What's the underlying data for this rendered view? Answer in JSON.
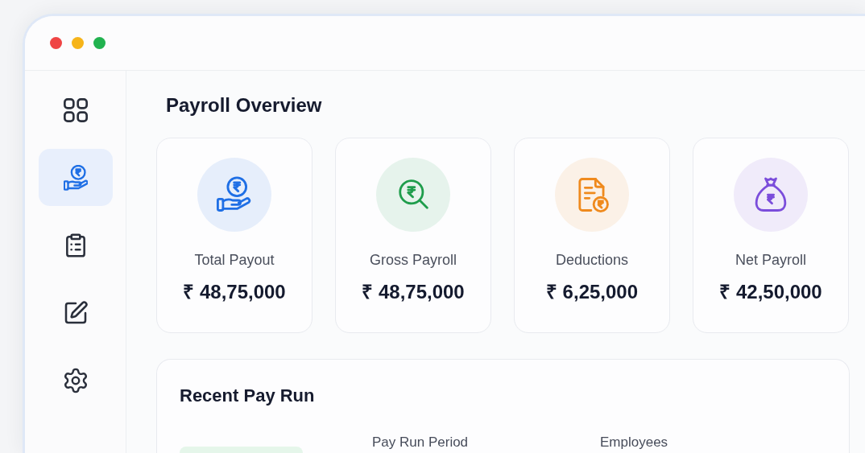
{
  "sidebar": {
    "items": [
      {
        "selected": false
      },
      {
        "selected": true
      },
      {
        "selected": false
      },
      {
        "selected": false
      },
      {
        "selected": false
      }
    ]
  },
  "overview": {
    "title": "Payroll Overview",
    "cards": [
      {
        "label": "Total Payout",
        "value": "₹ 48,75,000",
        "color": "#1f6fe5"
      },
      {
        "label": "Gross Payroll",
        "value": "₹ 48,75,000",
        "color": "#1f9d4c"
      },
      {
        "label": "Deductions",
        "value": "₹ 6,25,000",
        "color": "#ef8a1d"
      },
      {
        "label": "Net Payroll",
        "value": "₹ 42,50,000",
        "color": "#7b4ddb"
      }
    ]
  },
  "recent_pay_run": {
    "title": "Recent Pay Run",
    "columns": [
      "Pay Run Period",
      "Employees"
    ]
  }
}
